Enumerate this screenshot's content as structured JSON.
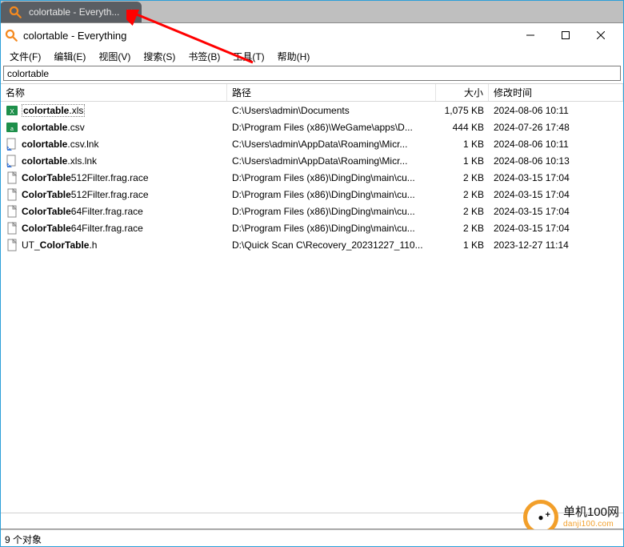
{
  "tab": {
    "title": "colortable - Everyth..."
  },
  "window": {
    "title": "colortable - Everything"
  },
  "menu": [
    "文件(F)",
    "编辑(E)",
    "视图(V)",
    "搜索(S)",
    "书签(B)",
    "工具(T)",
    "帮助(H)"
  ],
  "search": {
    "value": "colortable"
  },
  "columns": {
    "name": "名称",
    "path": "路径",
    "size": "大小",
    "date": "修改时间"
  },
  "rows": [
    {
      "icon": "xls",
      "name": "colortable.xls",
      "match": "colortable",
      "path": "C:\\Users\\admin\\Documents",
      "size": "1,075 KB",
      "date": "2024-08-06 10:11",
      "selected": true
    },
    {
      "icon": "csv",
      "name": "colortable.csv",
      "match": "colortable",
      "path": "D:\\Program Files (x86)\\WeGame\\apps\\D...",
      "size": "444 KB",
      "date": "2024-07-26 17:48"
    },
    {
      "icon": "lnk",
      "name": "colortable.csv.lnk",
      "match": "colortable",
      "path": "C:\\Users\\admin\\AppData\\Roaming\\Micr...",
      "size": "1 KB",
      "date": "2024-08-06 10:11"
    },
    {
      "icon": "lnk",
      "name": "colortable.xls.lnk",
      "match": "colortable",
      "path": "C:\\Users\\admin\\AppData\\Roaming\\Micr...",
      "size": "1 KB",
      "date": "2024-08-06 10:13"
    },
    {
      "icon": "file",
      "name": "ColorTable512Filter.frag.race",
      "match": "ColorTable",
      "path": "D:\\Program Files (x86)\\DingDing\\main\\cu...",
      "size": "2 KB",
      "date": "2024-03-15 17:04"
    },
    {
      "icon": "file",
      "name": "ColorTable512Filter.frag.race",
      "match": "ColorTable",
      "path": "D:\\Program Files (x86)\\DingDing\\main\\cu...",
      "size": "2 KB",
      "date": "2024-03-15 17:04"
    },
    {
      "icon": "file",
      "name": "ColorTable64Filter.frag.race",
      "match": "ColorTable",
      "path": "D:\\Program Files (x86)\\DingDing\\main\\cu...",
      "size": "2 KB",
      "date": "2024-03-15 17:04"
    },
    {
      "icon": "file",
      "name": "ColorTable64Filter.frag.race",
      "match": "ColorTable",
      "path": "D:\\Program Files (x86)\\DingDing\\main\\cu...",
      "size": "2 KB",
      "date": "2024-03-15 17:04"
    },
    {
      "icon": "file",
      "name": "UT_ColorTable.h",
      "match": "ColorTable",
      "path": "D:\\Quick Scan C\\Recovery_20231227_110...",
      "size": "1 KB",
      "date": "2023-12-27 11:14"
    }
  ],
  "status": {
    "text": ""
  },
  "host_status": {
    "text": "9 个对象"
  },
  "logo": {
    "big": "单机100网",
    "small": "danji100.com"
  }
}
